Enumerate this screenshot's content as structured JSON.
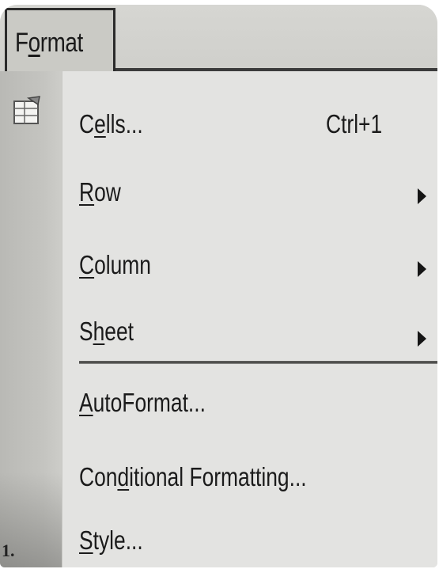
{
  "menubar": {
    "format_tab": {
      "label_prefix": "F",
      "label_accel": "o",
      "label_suffix": "rmat"
    }
  },
  "menu": {
    "items": [
      {
        "pre": "C",
        "acc": "e",
        "post": "lls...",
        "shortcut": "Ctrl+1",
        "submenu": false,
        "icon": "format-cells-icon"
      },
      {
        "pre": "",
        "acc": "R",
        "post": "ow",
        "shortcut": "",
        "submenu": true
      },
      {
        "pre": "",
        "acc": "C",
        "post": "olumn",
        "shortcut": "",
        "submenu": true
      },
      {
        "pre": "S",
        "acc": "h",
        "post": "eet",
        "shortcut": "",
        "submenu": true
      },
      {
        "pre": "",
        "acc": "A",
        "post": "utoFormat...",
        "shortcut": "",
        "submenu": false
      },
      {
        "pre": "Con",
        "acc": "d",
        "post": "itional Formatting...",
        "shortcut": "",
        "submenu": false
      },
      {
        "pre": "",
        "acc": "S",
        "post": "tyle...",
        "shortcut": "",
        "submenu": false
      }
    ]
  },
  "page": {
    "number": "1."
  },
  "colors": {
    "menu_background": "#e3e3e1",
    "icon_strip": "#c4c4c0",
    "menubar": "#d6d6d2",
    "text": "#1b1b1b"
  }
}
